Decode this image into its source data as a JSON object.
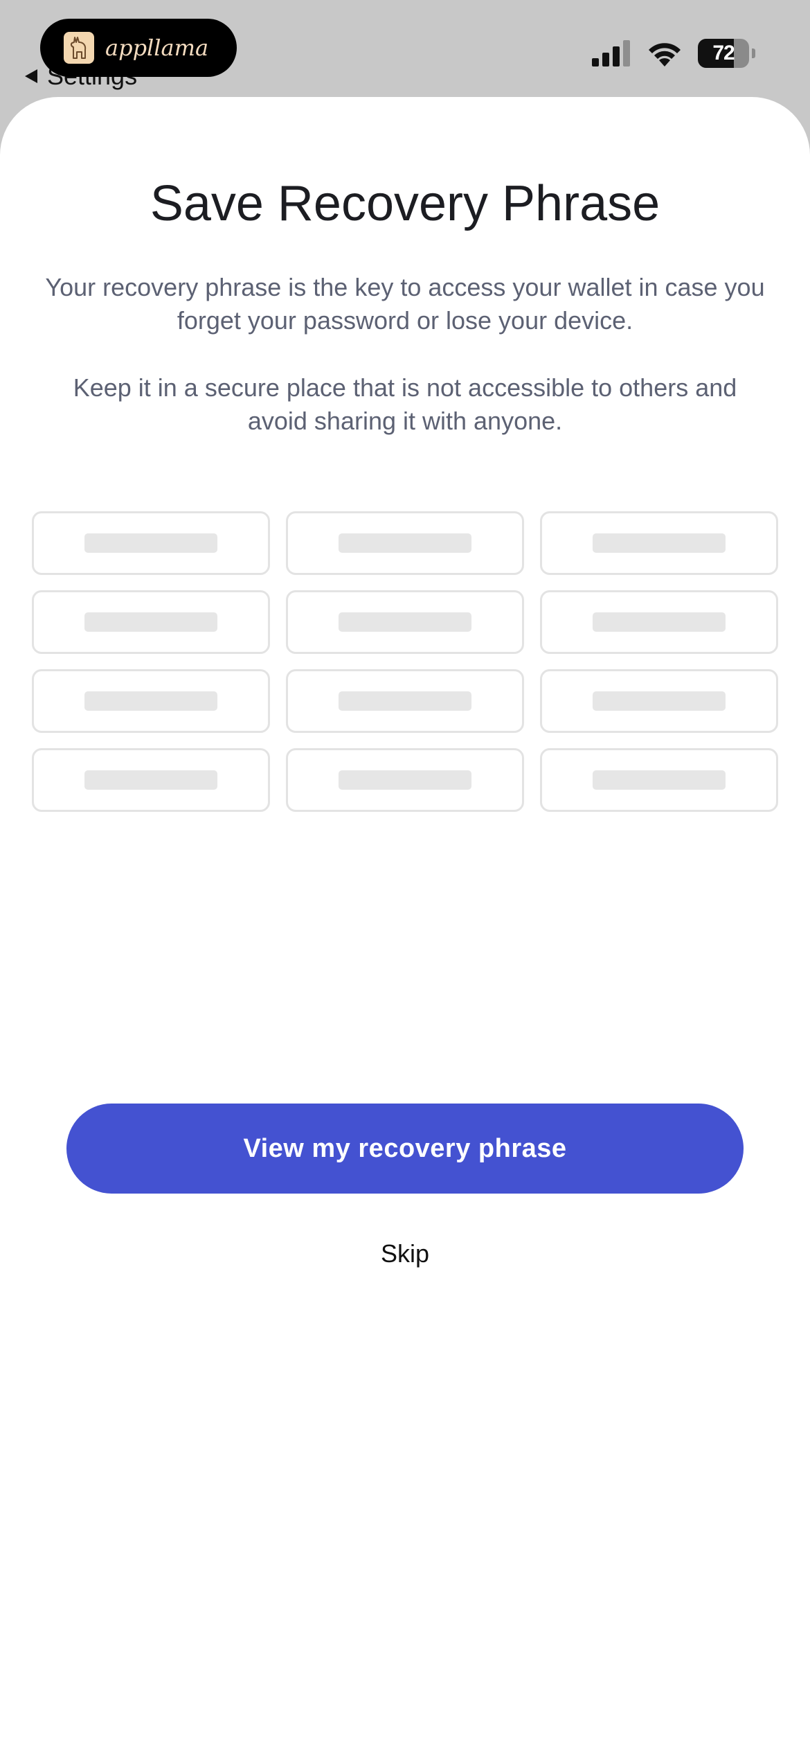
{
  "status_bar": {
    "island_app_name": "appllama",
    "back_label": "Settings",
    "battery_level": "72",
    "signal_icon": "cellular-signal-icon",
    "wifi_icon": "wifi-icon",
    "battery_icon": "battery-icon"
  },
  "screen": {
    "title": "Save Recovery Phrase",
    "description_1": "Your recovery phrase is the key to access your wallet in case you forget your password or lose your device.",
    "description_2": "Keep it in a secure place that is not accessible to others and avoid sharing it with anyone."
  },
  "phrase_grid": {
    "slot_count": 12
  },
  "actions": {
    "primary_label": "View my recovery phrase",
    "skip_label": "Skip"
  },
  "colors": {
    "accent": "#4452d1",
    "title_text": "#1c1d22",
    "body_text": "#5c6173",
    "slot_border": "#e3e3e3",
    "placeholder": "#e6e6e6"
  }
}
